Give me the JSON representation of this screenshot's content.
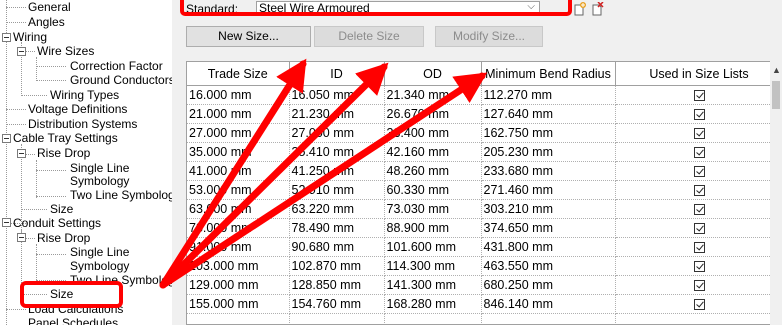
{
  "tree": {
    "items": [
      {
        "label": "General"
      },
      {
        "label": "Angles"
      },
      {
        "label": "Wiring"
      },
      {
        "label": "Wire Sizes"
      },
      {
        "label": "Correction Factor"
      },
      {
        "label": "Ground Conductors"
      },
      {
        "label": "Wiring Types"
      },
      {
        "label": "Voltage Definitions"
      },
      {
        "label": "Distribution Systems"
      },
      {
        "label": "Cable Tray Settings"
      },
      {
        "label": "Rise Drop"
      },
      {
        "label": "Single Line"
      },
      {
        "label": "Symbology"
      },
      {
        "label": "Two Line Symbology"
      },
      {
        "label": "Size"
      },
      {
        "label": "Conduit Settings"
      },
      {
        "label": "Rise Drop"
      },
      {
        "label": "Single Line"
      },
      {
        "label": "Symbology"
      },
      {
        "label": "Two Line Symbology"
      },
      {
        "label": "Size"
      },
      {
        "label": "Load Calculations"
      },
      {
        "label": "Panel Schedules"
      }
    ]
  },
  "standard": {
    "label": "Standard:",
    "value": "Steel Wire Armoured"
  },
  "buttons": {
    "new_size": "New Size...",
    "delete_size": "Delete Size",
    "modify_size": "Modify Size..."
  },
  "table": {
    "headers": [
      "Trade Size",
      "ID",
      "OD",
      "Minimum Bend Radius",
      "Used in Size Lists"
    ],
    "rows": [
      [
        "16.000 mm",
        "16.050 mm",
        "21.340 mm",
        "112.270 mm"
      ],
      [
        "21.000 mm",
        "21.230 mm",
        "26.670 mm",
        "127.640 mm"
      ],
      [
        "27.000 mm",
        "27.000 mm",
        "33.400 mm",
        "162.750 mm"
      ],
      [
        "35.000 mm",
        "35.410 mm",
        "42.160 mm",
        "205.230 mm"
      ],
      [
        "41.000 mm",
        "41.250 mm",
        "48.260 mm",
        "233.680 mm"
      ],
      [
        "53.000 mm",
        "52.910 mm",
        "60.330 mm",
        "271.460 mm"
      ],
      [
        "63.000 mm",
        "63.220 mm",
        "73.030 mm",
        "303.210 mm"
      ],
      [
        "78.000 mm",
        "78.490 mm",
        "88.900 mm",
        "374.650 mm"
      ],
      [
        "91.000 mm",
        "90.680 mm",
        "101.600 mm",
        "431.800 mm"
      ],
      [
        "103.000 mm",
        "102.870 mm",
        "114.300 mm",
        "463.550 mm"
      ],
      [
        "129.000 mm",
        "128.850 mm",
        "141.300 mm",
        "680.250 mm"
      ],
      [
        "155.000 mm",
        "154.760 mm",
        "168.280 mm",
        "846.140 mm"
      ]
    ]
  },
  "icons": {
    "add_standard": "add-standard-icon",
    "delete_standard": "delete-standard-icon",
    "checkbox": "checkbox-checked-icon"
  },
  "colors": {
    "annotation_red": "#ff0000",
    "panel_bg": "#f0f0f0"
  }
}
